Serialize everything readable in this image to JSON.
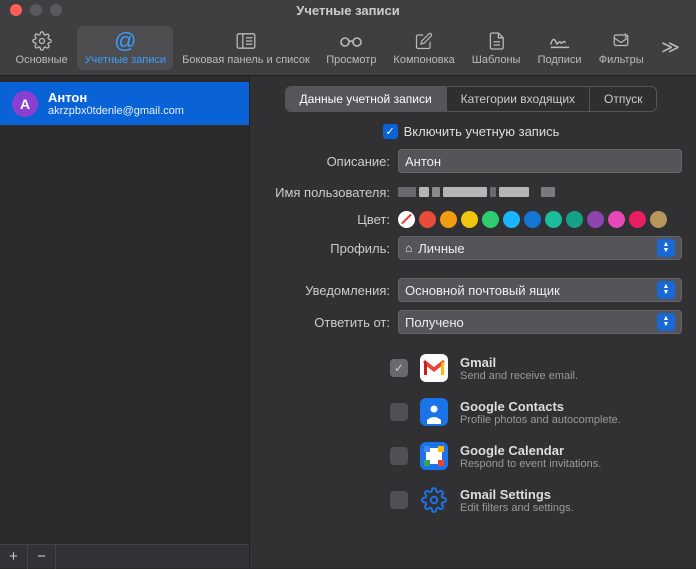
{
  "window": {
    "title": "Учетные записи"
  },
  "toolbar": {
    "items": [
      {
        "label": "Основные"
      },
      {
        "label": "Учетные записи"
      },
      {
        "label": "Боковая панель и список"
      },
      {
        "label": "Просмотр"
      },
      {
        "label": "Компоновка"
      },
      {
        "label": "Шаблоны"
      },
      {
        "label": "Подписи"
      },
      {
        "label": "Фильтры"
      }
    ]
  },
  "sidebar": {
    "accounts": [
      {
        "initial": "A",
        "name": "Антон",
        "email": "akrzpbx0tdenle@gmail.com"
      }
    ]
  },
  "tabs": [
    {
      "label": "Данные учетной записи",
      "active": true
    },
    {
      "label": "Категории входящих",
      "active": false
    },
    {
      "label": "Отпуск",
      "active": false
    }
  ],
  "form": {
    "enable_label": "Включить учетную запись",
    "description_label": "Описание:",
    "description_value": "Антон",
    "username_label": "Имя пользователя:",
    "color_label": "Цвет:",
    "profile_label": "Профиль:",
    "profile_value": "Личные",
    "notifications_label": "Уведомления:",
    "notifications_value": "Основной почтовый ящик",
    "reply_label": "Ответить от:",
    "reply_value": "Получено"
  },
  "colors": [
    "none",
    "#e74c3c",
    "#f39c12",
    "#f1c40f",
    "#2ecc71",
    "#19b5fe",
    "#1676d4",
    "#1abc9c",
    "#16a085",
    "#8e44ad",
    "#e648b7",
    "#e91e63",
    "#b7955b"
  ],
  "services": [
    {
      "title": "Gmail",
      "desc": "Send and receive email.",
      "enabled": true,
      "iconbg": "#fff"
    },
    {
      "title": "Google Contacts",
      "desc": "Profile photos and autocomplete.",
      "enabled": false,
      "iconbg": "#1a73e8"
    },
    {
      "title": "Google Calendar",
      "desc": "Respond to event invitations.",
      "enabled": false,
      "iconbg": "#1a73e8"
    },
    {
      "title": "Gmail Settings",
      "desc": "Edit filters and settings.",
      "enabled": false,
      "iconbg": "transparent"
    }
  ]
}
